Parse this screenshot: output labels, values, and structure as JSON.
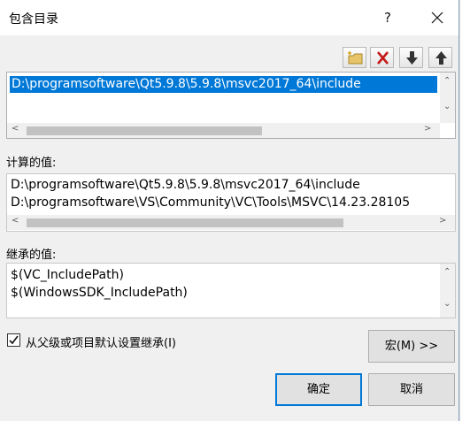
{
  "dialog": {
    "title": "包含目录",
    "help_glyph": "?",
    "toolbar": {
      "new_line_icon": "new-line-folder-icon",
      "delete_icon": "delete-x-icon",
      "move_down_icon": "arrow-down-icon",
      "move_up_icon": "arrow-up-icon"
    },
    "list": {
      "items": [
        "D:\\programsoftware\\Qt5.9.8\\5.9.8\\msvc2017_64\\include"
      ]
    },
    "evaluated": {
      "label": "计算的值:",
      "lines": [
        "D:\\programsoftware\\Qt5.9.8\\5.9.8\\msvc2017_64\\include",
        "D:\\programsoftware\\VS\\Community\\VC\\Tools\\MSVC\\14.23.28105"
      ]
    },
    "inherited": {
      "label": "继承的值:",
      "lines": [
        "$(VC_IncludePath)",
        "$(WindowsSDK_IncludePath)"
      ]
    },
    "inherit_checkbox": {
      "label": "从父级或项目默认设置继承(I)",
      "checked": true
    },
    "buttons": {
      "macros": "宏(M) >>",
      "ok": "确定",
      "cancel": "取消"
    }
  },
  "colors": {
    "selection": "#0078d7",
    "dialog_bg": "#f0f0f0",
    "delete_icon": "#c41a1a"
  }
}
